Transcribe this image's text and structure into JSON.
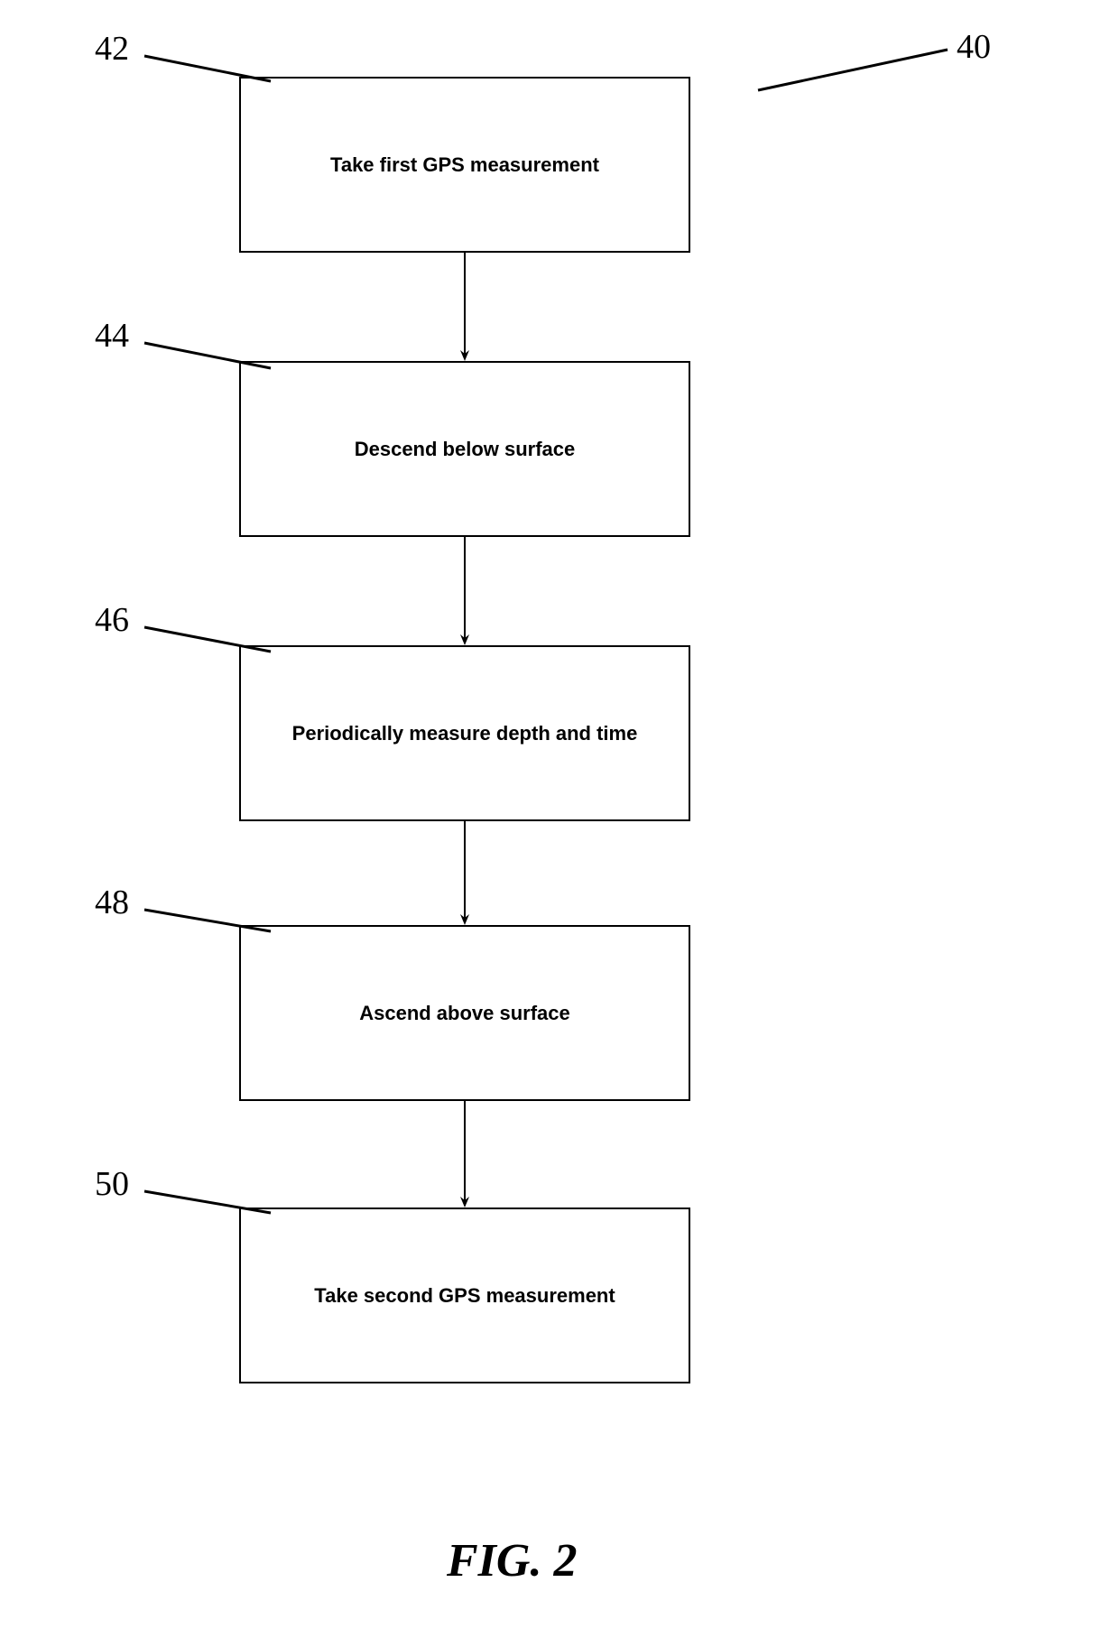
{
  "figure_label": "FIG. 2",
  "refs": {
    "overall": "40",
    "step1": "42",
    "step2": "44",
    "step3": "46",
    "step4": "48",
    "step5": "50"
  },
  "steps": {
    "s1": "Take first GPS measurement",
    "s2": "Descend below surface",
    "s3": "Periodically measure depth and time",
    "s4": "Ascend above surface",
    "s5": "Take second GPS measurement"
  },
  "chart_data": {
    "type": "flowchart",
    "overall_ref": "40",
    "nodes": [
      {
        "id": "s1",
        "ref": "42",
        "label": "Take first GPS measurement"
      },
      {
        "id": "s2",
        "ref": "44",
        "label": "Descend below surface"
      },
      {
        "id": "s3",
        "ref": "46",
        "label": "Periodically measure depth and time"
      },
      {
        "id": "s4",
        "ref": "48",
        "label": "Ascend above surface"
      },
      {
        "id": "s5",
        "ref": "50",
        "label": "Take second GPS measurement"
      }
    ],
    "edges": [
      {
        "from": "s1",
        "to": "s2"
      },
      {
        "from": "s2",
        "to": "s3"
      },
      {
        "from": "s3",
        "to": "s4"
      },
      {
        "from": "s4",
        "to": "s5"
      }
    ]
  }
}
